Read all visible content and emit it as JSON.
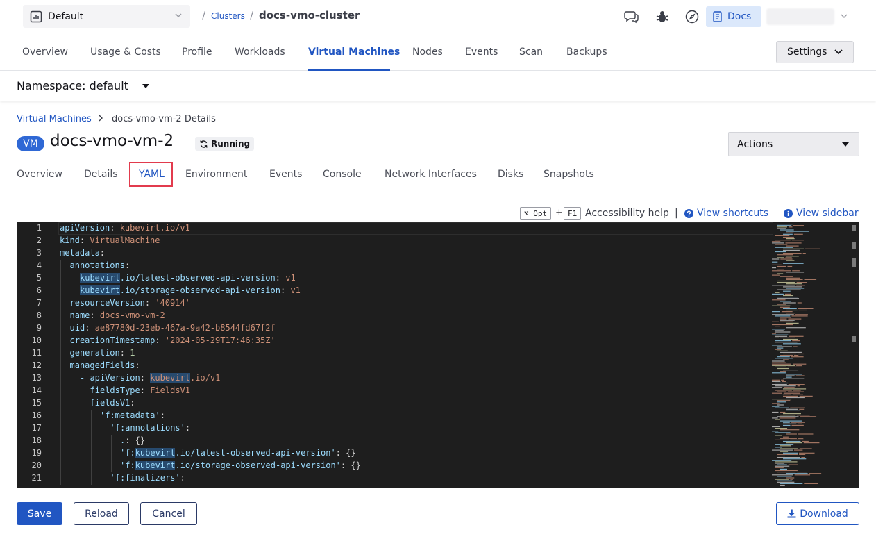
{
  "top": {
    "workspace": "Default",
    "breadcrumb_sep": "/",
    "clusters_link": "Clusters",
    "cluster_name": "docs-vmo-cluster",
    "docs_label": "Docs"
  },
  "main_tabs": [
    "Overview",
    "Usage & Costs",
    "Profile",
    "Workloads",
    "Virtual Machines",
    "Nodes",
    "Events",
    "Scan",
    "Backups"
  ],
  "settings_label": "Settings",
  "namespace": "Namespace: default",
  "details": {
    "breadcrumb_link": "Virtual Machines",
    "breadcrumb_current": "docs-vmo-vm-2 Details",
    "badge": "VM",
    "title": "docs-vmo-vm-2",
    "status": "Running",
    "actions_label": "Actions"
  },
  "sub_tabs": [
    "Overview",
    "Details",
    "YAML",
    "Environment",
    "Events",
    "Console",
    "Network Interfaces",
    "Disks",
    "Snapshots"
  ],
  "editor_toolbar": {
    "key1": "⌥ Opt",
    "plus": "+",
    "key2": "F1",
    "accessibility_help": "Accessibility help",
    "separator": "|",
    "view_shortcuts": "View shortcuts",
    "view_sidebar": "View sidebar"
  },
  "yaml": [
    {
      "n": "1",
      "k": "apiVersion",
      "v": "kubevirt.io/v1"
    },
    {
      "n": "2",
      "k": "kind",
      "v": "VirtualMachine"
    },
    {
      "n": "3",
      "k": "metadata",
      "v": ""
    },
    {
      "n": "4",
      "k": "annotations",
      "v": ""
    },
    {
      "n": "5",
      "k": "kubevirt.io/latest-observed-api-version",
      "v": "v1"
    },
    {
      "n": "6",
      "k": "kubevirt.io/storage-observed-api-version",
      "v": "v1"
    },
    {
      "n": "7",
      "k": "resourceVersion",
      "v": "'40914'"
    },
    {
      "n": "8",
      "k": "name",
      "v": "docs-vmo-vm-2"
    },
    {
      "n": "9",
      "k": "uid",
      "v": "ae87780d-23eb-467a-9a42-b8544fd67f2f"
    },
    {
      "n": "10",
      "k": "creationTimestamp",
      "v": "'2024-05-29T17:46:35Z'"
    },
    {
      "n": "11",
      "k": "generation",
      "v": "1"
    },
    {
      "n": "12",
      "k": "managedFields",
      "v": ""
    },
    {
      "n": "13",
      "k": "- apiVersion",
      "v": "kubevirt.io/v1"
    },
    {
      "n": "14",
      "k": "fieldsType",
      "v": "FieldsV1"
    },
    {
      "n": "15",
      "k": "fieldsV1",
      "v": ""
    },
    {
      "n": "16",
      "k": "'f:metadata'",
      "v": ""
    },
    {
      "n": "17",
      "k": "'f:annotations'",
      "v": ""
    },
    {
      "n": "18",
      "k": ".",
      "v": "{}"
    },
    {
      "n": "19",
      "k": "'f:kubevirt.io/latest-observed-api-version'",
      "v": "{}"
    },
    {
      "n": "20",
      "k": "'f:kubevirt.io/storage-observed-api-version'",
      "v": "{}"
    },
    {
      "n": "21",
      "k": "'f:finalizers'",
      "v": ""
    }
  ],
  "footer": {
    "save": "Save",
    "reload": "Reload",
    "cancel": "Cancel",
    "download": "Download"
  },
  "colors": {
    "accent": "#2156c2",
    "editor_bg": "#1e1e1e",
    "yaml_key": "#9cdcfe",
    "yaml_value": "#ce9178",
    "highlight_box": "#e23b4d"
  }
}
